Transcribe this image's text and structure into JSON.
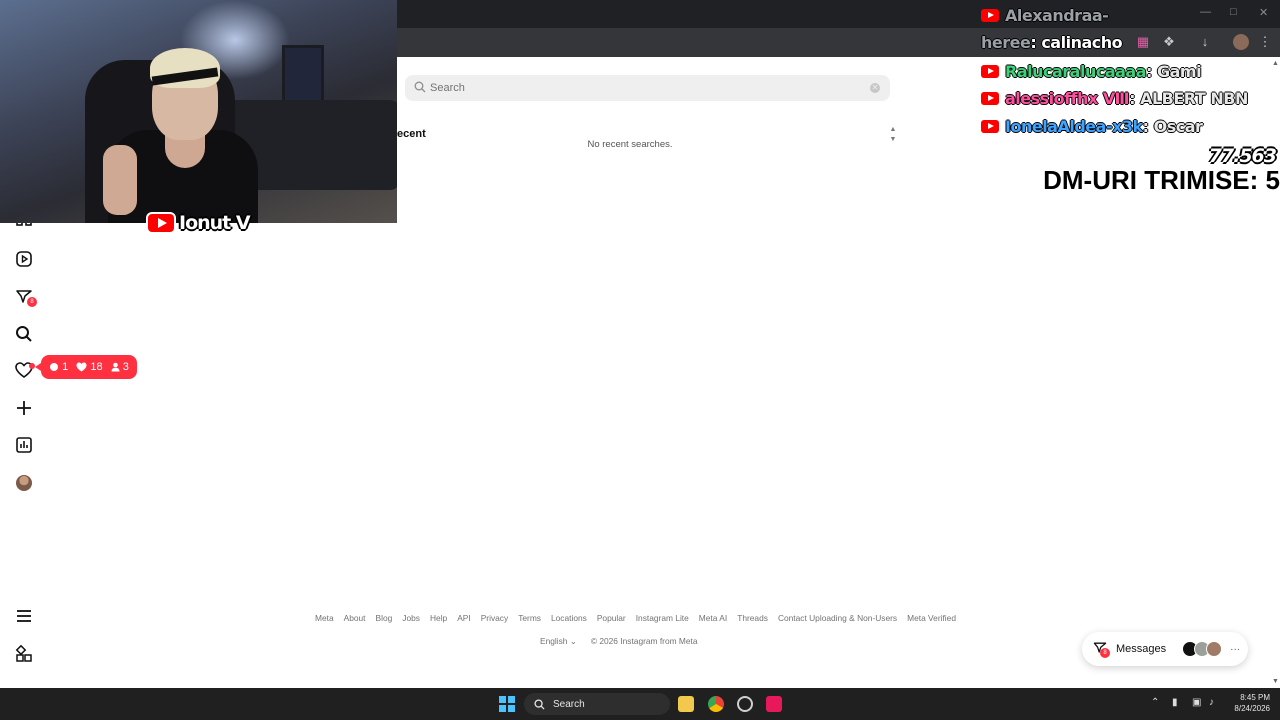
{
  "search": {
    "placeholder": "Search",
    "recent_heading": "ecent",
    "empty_text": "No recent searches."
  },
  "notifications": {
    "comments": "1",
    "likes": "18",
    "followers": "3"
  },
  "sidebar": {
    "messages_badge": "8"
  },
  "footer": {
    "links": [
      "Meta",
      "About",
      "Blog",
      "Jobs",
      "Help",
      "API",
      "Privacy",
      "Terms",
      "Locations",
      "Popular",
      "Instagram Lite",
      "Meta AI",
      "Threads",
      "Contact Uploading & Non-Users",
      "Meta Verified"
    ],
    "language": "English",
    "copyright": "© 2026 Instagram from Meta"
  },
  "messages_float": {
    "label": "Messages",
    "badge": "8"
  },
  "stream_overlay": {
    "streamer_name": "Ionut V",
    "chat": [
      {
        "user": "Alexandraa-",
        "message": ""
      },
      {
        "user": "heree",
        "message": ": calinacho"
      },
      {
        "user": "Ralucaralucaaaa",
        "message": ": Gami"
      },
      {
        "user": "alessioffhx Ⅷ",
        "message": ": ALBERT NBN"
      },
      {
        "user": "IonelaAldea-x3k",
        "message": ": Oscar"
      }
    ],
    "counter": "77.563",
    "dm_label": "DM-URI TRIMISE: 5"
  },
  "taskbar": {
    "search_label": "Search",
    "time": "8:45 PM",
    "date": "8/24/2026"
  },
  "colors": {
    "chat_user_1": "#9aa0a6",
    "chat_user_ralu": "#3fd07a",
    "chat_user_alessio": "#ff4fa0",
    "chat_user_ionela": "#3fa4ff",
    "notification_red": "#ff3040",
    "windows_blue": "#4cc2ff"
  }
}
